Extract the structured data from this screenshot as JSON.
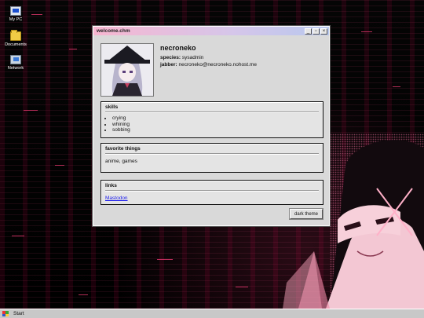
{
  "desktop": {
    "icons": [
      {
        "label": "My PC",
        "icon": "computer-icon"
      },
      {
        "label": "Documents",
        "icon": "folder-icon"
      },
      {
        "label": "Network",
        "icon": "network-icon"
      }
    ]
  },
  "window": {
    "title": "welcome.chm",
    "buttons": {
      "minimize": "_",
      "maximize": "▫",
      "close": "×"
    }
  },
  "profile": {
    "name": "necroneko",
    "species_label": "species:",
    "species_value": "sysadmin",
    "jabber_label": "jabber:",
    "jabber_value": "necroneko@necroneko.nohost.me"
  },
  "skills": {
    "title": "skills",
    "items": [
      "crying",
      "whining",
      "sobbing"
    ]
  },
  "favorites": {
    "title": "favorite things",
    "text": "anime, games"
  },
  "links": {
    "title": "links",
    "items": [
      "Mastodon"
    ]
  },
  "theme_button": "dark theme",
  "taskbar": {
    "start_label": "Start"
  },
  "colors": {
    "accent_pink": "#f7b6d0",
    "link": "#1a1aee",
    "glitch": "#ff3d7a"
  }
}
